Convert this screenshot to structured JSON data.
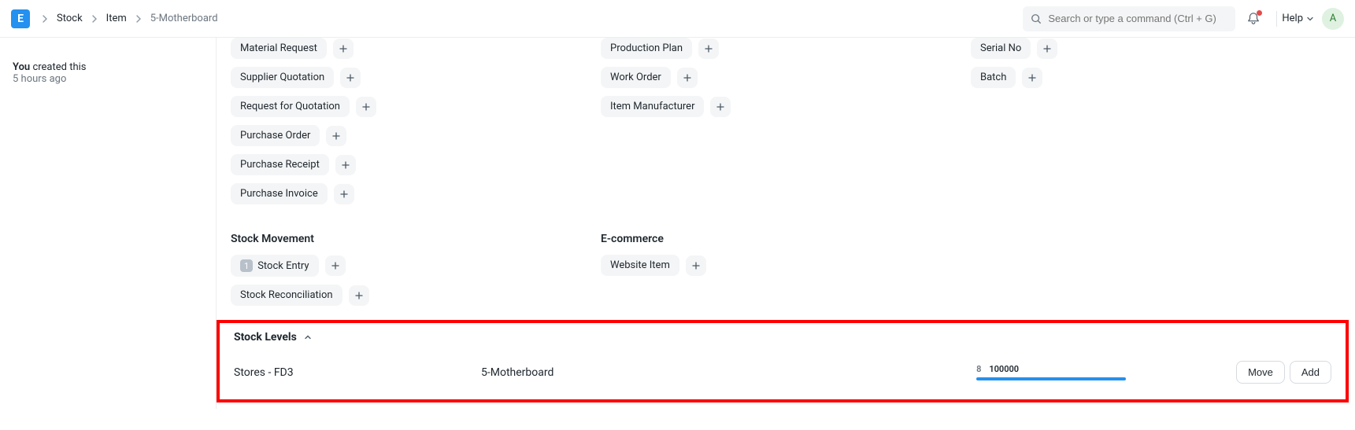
{
  "header": {
    "logo_letter": "E",
    "breadcrumbs": [
      "Stock",
      "Item",
      "5-Motherboard"
    ],
    "search_placeholder": "Search or type a command (Ctrl + G)",
    "help_label": "Help",
    "avatar_letter": "A"
  },
  "sidebar": {
    "top_line": "",
    "you_label": "You",
    "created_label": "created this",
    "time_label": "5 hours ago"
  },
  "columns": {
    "col1": [
      {
        "label": "Material Request"
      },
      {
        "label": "Supplier Quotation"
      },
      {
        "label": "Request for Quotation"
      },
      {
        "label": "Purchase Order"
      },
      {
        "label": "Purchase Receipt"
      },
      {
        "label": "Purchase Invoice"
      }
    ],
    "col2": [
      {
        "label": "Production Plan"
      },
      {
        "label": "Work Order"
      },
      {
        "label": "Item Manufacturer"
      }
    ],
    "col3": [
      {
        "label": "Serial No"
      },
      {
        "label": "Batch"
      }
    ]
  },
  "sections": {
    "stock_movement": {
      "title": "Stock Movement",
      "items": [
        {
          "label": "Stock Entry",
          "count": "1"
        },
        {
          "label": "Stock Reconciliation"
        }
      ]
    },
    "ecommerce": {
      "title": "E-commerce",
      "items": [
        {
          "label": "Website Item"
        }
      ]
    }
  },
  "stock_levels": {
    "title": "Stock Levels",
    "row": {
      "warehouse": "Stores - FD3",
      "item": "5-Motherboard",
      "stat_label": "8",
      "stat_value": "100000"
    },
    "move_label": "Move",
    "add_label": "Add"
  }
}
